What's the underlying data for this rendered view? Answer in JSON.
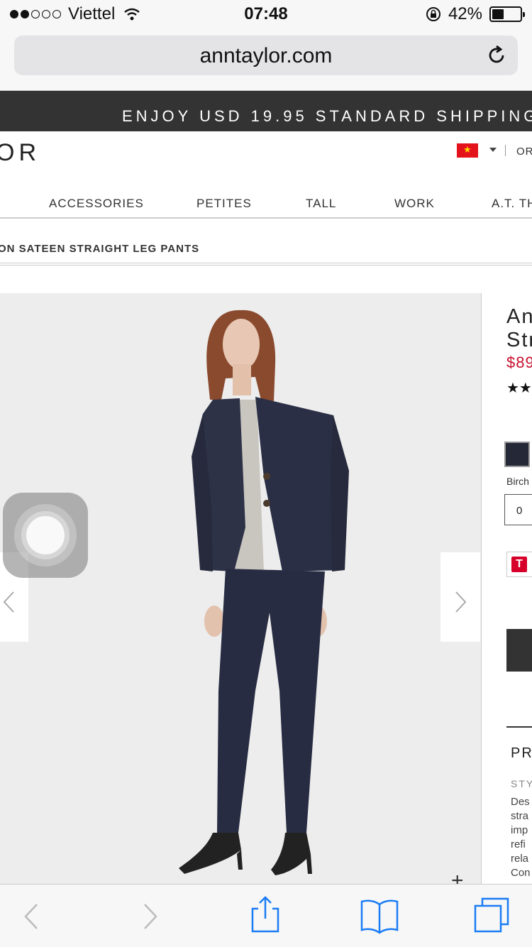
{
  "status_bar": {
    "carrier": "Viettel",
    "time": "07:48",
    "battery": "42%",
    "battery_level": 0.42
  },
  "browser": {
    "url": "anntaylor.com"
  },
  "promo": {
    "text": "ENJOY USD 19.95 STANDARD SHIPPING"
  },
  "header": {
    "logo": "OR",
    "order_link": "OR"
  },
  "nav": {
    "items": [
      "ACCESSORIES",
      "PETITES",
      "TALL",
      "WORK",
      "A.T. TH"
    ]
  },
  "breadcrumb": "ON SATEEN STRAIGHT LEG PANTS",
  "product": {
    "title_line1": "An",
    "title_line2": "Str",
    "price": "$89",
    "stars": "★★",
    "color_name": "Birch",
    "size_value": "0",
    "badge_letter": "T",
    "section_heading": "PR",
    "style_label": "STY",
    "description_lines": [
      "Des",
      "stra",
      "imp",
      "refi",
      "rela",
      "Con"
    ],
    "zoom_symbol": "+"
  },
  "colors": {
    "promo_bg": "#333333",
    "price": "#c8102e",
    "swatch": "#252836",
    "badge": "#d6002a"
  }
}
